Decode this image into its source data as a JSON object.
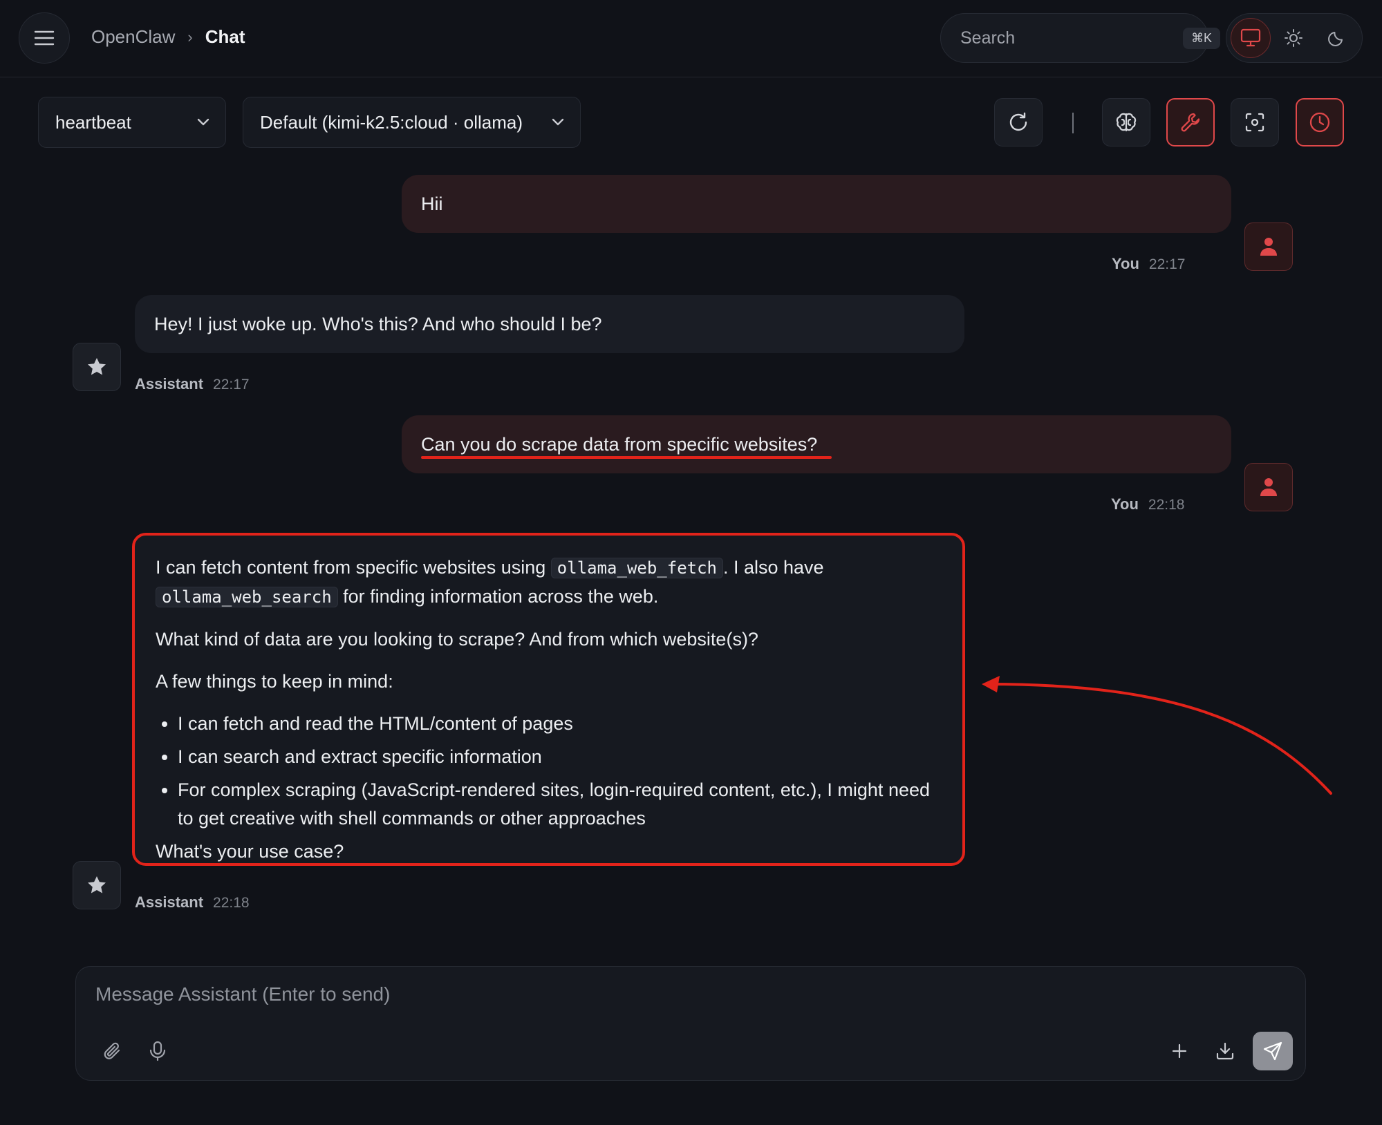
{
  "header": {
    "app_name": "OpenClaw",
    "separator": "›",
    "page_title": "Chat",
    "search_placeholder": "Search",
    "search_shortcut": "⌘K"
  },
  "toolbar": {
    "session_label": "heartbeat",
    "model_label": "Default (kimi-k2.5:cloud · ollama)",
    "separator": "|"
  },
  "messages": [
    {
      "role": "user",
      "text": "Hii",
      "author": "You",
      "time": "22:17"
    },
    {
      "role": "assistant",
      "text": "Hey! I just woke up. Who's this? And who should I be?",
      "author": "Assistant",
      "time": "22:17"
    },
    {
      "role": "user",
      "text": "Can you do scrape data from specific websites?",
      "author": "You",
      "time": "22:18"
    },
    {
      "role": "assistant",
      "author": "Assistant",
      "time": "22:18",
      "p1_a": "I can fetch content from specific websites using",
      "p1_code1": "ollama_web_fetch",
      "p1_b": ". I also have",
      "p1_code2": "ollama_web_search",
      "p1_c": "for finding information across the web.",
      "p2": "What kind of data are you looking to scrape? And from which website(s)?",
      "p3": "A few things to keep in mind:",
      "bullets": [
        "I can fetch and read the HTML/content of pages",
        "I can search and extract specific information",
        "For complex scraping (JavaScript-rendered sites, login-required content, etc.), I might need to get creative with shell commands or other approaches"
      ],
      "p4": "What's your use case?"
    }
  ],
  "composer": {
    "placeholder": "Message Assistant (Enter to send)"
  },
  "colors": {
    "accent": "#e0484a",
    "annotation": "#e2231a",
    "background": "#101218"
  },
  "icons": [
    "menu-icon",
    "monitor-icon",
    "sun-icon",
    "moon-icon",
    "chevron-down-icon",
    "refresh-icon",
    "brain-icon",
    "wrench-icon",
    "focus-icon",
    "clock-icon",
    "user-icon",
    "star-icon",
    "paperclip-icon",
    "microphone-icon",
    "plus-icon",
    "download-icon",
    "send-icon"
  ]
}
